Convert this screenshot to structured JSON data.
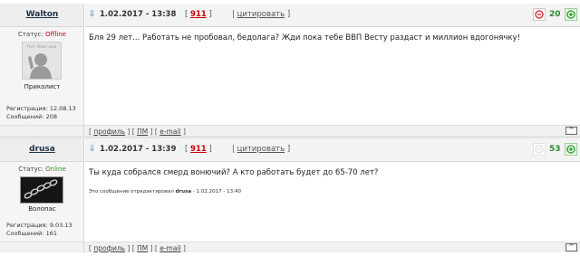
{
  "posts": [
    {
      "author": "Walton",
      "link_icon": "⇩",
      "date": "1.02.2017 - 13:38",
      "number": "911",
      "quote_label": "цитировать",
      "rating": {
        "value": "20",
        "minus_icon": "thumb-down-icon",
        "plus_icon": "thumb-up-icon"
      },
      "status_label": "Статус:",
      "status": "Offline",
      "avatar_text": "Нет Аватара",
      "rank": "Приколист",
      "registration_label": "Регистрация:",
      "registration": "12.08.13",
      "messages_label": "Сообщений:",
      "messages": "208",
      "message": "Бля 29 лет... Работать не пробовал, бедолага? Жди пока тебе ВВП Весту раздаст и миллион вдогонячку!",
      "edited": null,
      "footer": {
        "profile": "профиль",
        "pm": "ПМ",
        "email": "e-mail",
        "top": "^"
      }
    },
    {
      "author": "drusa",
      "link_icon": "⇩",
      "date": "1.02.2017 - 13:39",
      "number": "911",
      "quote_label": "цитировать",
      "rating": {
        "value": "53",
        "minus_icon": "thumb-down-icon",
        "plus_icon": "thumb-up-icon"
      },
      "status_label": "Статус:",
      "status": "Online",
      "avatar_text": "",
      "rank": "Волопас",
      "registration_label": "Регистрация:",
      "registration": "9.03.13",
      "messages_label": "Сообщений:",
      "messages": "161",
      "message": "Ты куда собрался смерд вонючий? А кто работать будет до 65-70 лет?",
      "edited": {
        "prefix": "Это сообщение отредактировал",
        "user": "drusa",
        "suffix": "- 1.02.2017 - 13:40"
      },
      "footer": {
        "profile": "профиль",
        "pm": "ПМ",
        "email": "e-mail",
        "top": "^"
      }
    }
  ],
  "colors": {
    "offline": "#cc0000",
    "online": "#2c9a2c",
    "post_number": "#cc0000",
    "rating": "#2c8a2c"
  }
}
